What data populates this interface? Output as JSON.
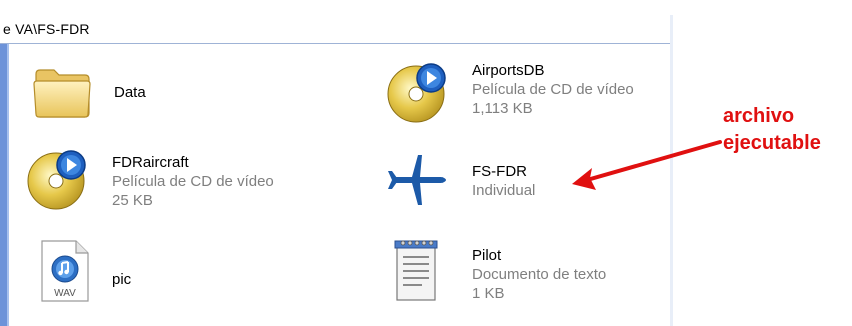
{
  "address_bar": {
    "path": "e VA\\FS-FDR"
  },
  "files": [
    {
      "name": "Data",
      "type": "",
      "size": "",
      "icon": "folder-icon"
    },
    {
      "name": "AirportsDB",
      "type": "Película de CD de vídeo",
      "size": "1,113 KB",
      "icon": "vcd-disc-icon"
    },
    {
      "name": "FDRaircraft",
      "type": "Película de CD de vídeo",
      "size": "25 KB",
      "icon": "vcd-disc-icon"
    },
    {
      "name": "FS-FDR",
      "type": "Individual",
      "size": "",
      "icon": "airplane-icon"
    },
    {
      "name": "pic",
      "type": "",
      "size": "",
      "icon": "wav-file-icon"
    },
    {
      "name": "Pilot",
      "type": "Documento de texto",
      "size": "1 KB",
      "icon": "notepad-icon"
    }
  ],
  "annotation": {
    "line1": "archivo",
    "line2": "ejecutable",
    "color": "#e01010"
  },
  "colors": {
    "sidebar": "#6d93d9",
    "secondary_text": "#7f7f7f"
  }
}
